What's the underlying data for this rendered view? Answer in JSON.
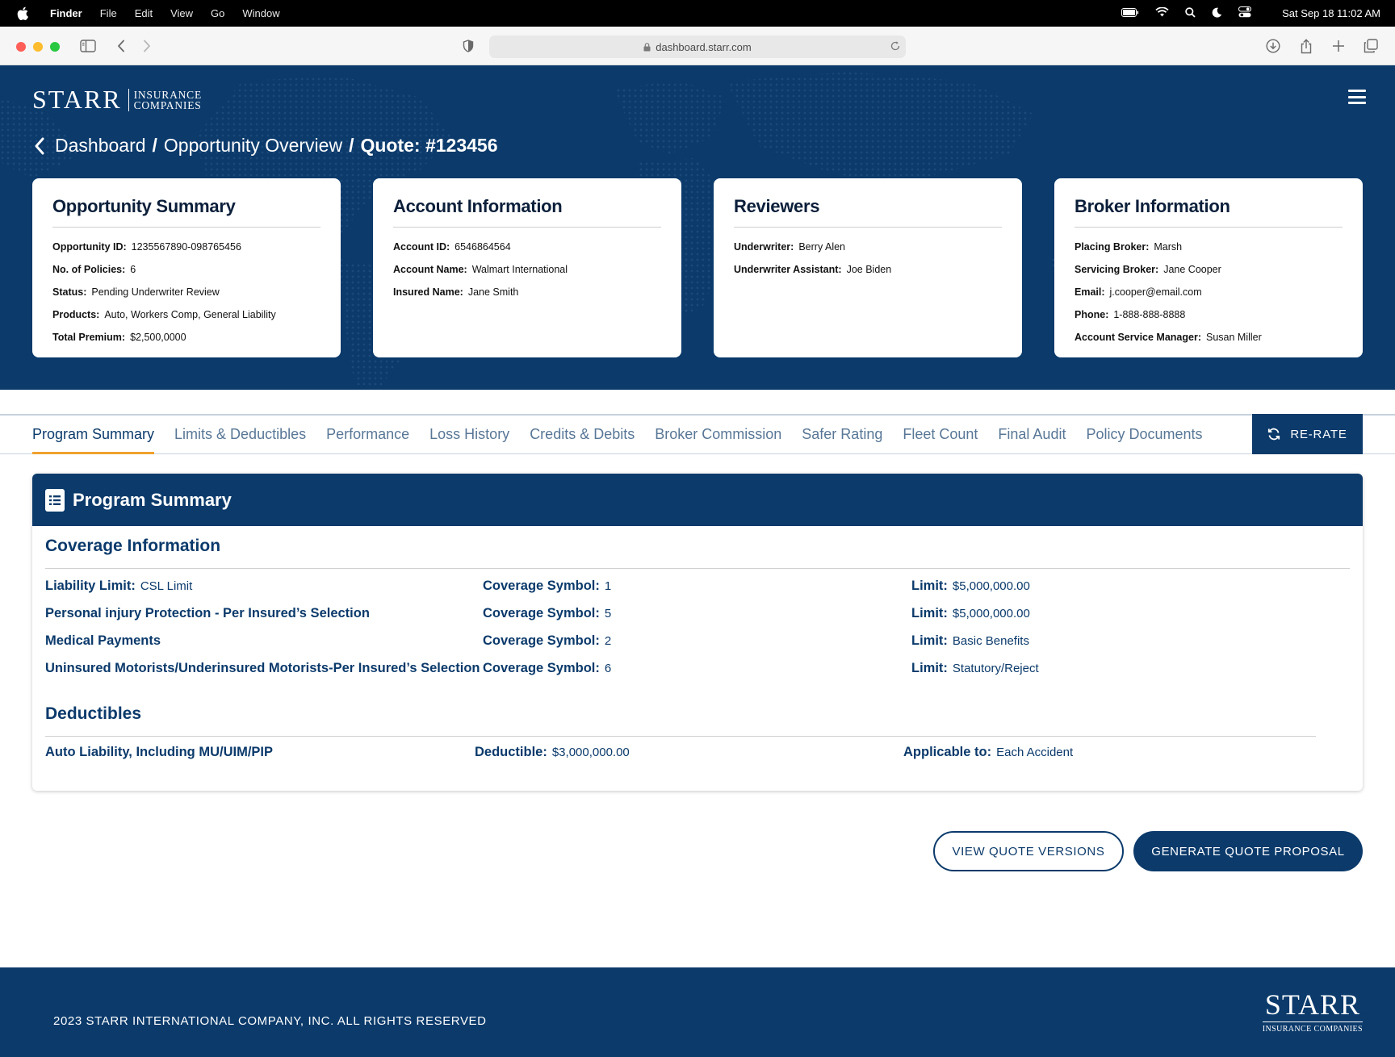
{
  "menubar": {
    "app": "Finder",
    "items": [
      "File",
      "Edit",
      "View",
      "Go",
      "Window"
    ],
    "clock": "Sat Sep 18  11:02 AM",
    "status_icons": [
      "battery-icon",
      "wifi-icon",
      "spotlight-icon",
      "focus-moon-icon",
      "control-center-icon"
    ]
  },
  "browser": {
    "url": "dashboard.starr.com"
  },
  "logo": {
    "name": "STARR",
    "sub1": "INSURANCE",
    "sub2": "COMPANIES"
  },
  "breadcrumb": {
    "items": [
      "Dashboard",
      "Opportunity Overview"
    ],
    "current": "Quote: #123456",
    "separator": "/"
  },
  "cards": [
    {
      "title": "Opportunity Summary",
      "rows": [
        {
          "k": "Opportunity ID:",
          "v": "1235567890-098765456"
        },
        {
          "k": "No. of Policies:",
          "v": "6"
        },
        {
          "k": "Status:",
          "v": "Pending Underwriter Review"
        },
        {
          "k": "Products:",
          "v": "Auto, Workers Comp,  General Liability"
        },
        {
          "k": "Total Premium:",
          "v": "$2,500,0000"
        }
      ]
    },
    {
      "title": "Account Information",
      "rows": [
        {
          "k": "Account ID:",
          "v": "6546864564"
        },
        {
          "k": "Account Name:",
          "v": "Walmart International"
        },
        {
          "k": "Insured Name:",
          "v": "Jane Smith"
        }
      ]
    },
    {
      "title": "Reviewers",
      "rows": [
        {
          "k": "Underwriter:",
          "v": "Berry Alen"
        },
        {
          "k": "Underwriter Assistant:",
          "v": "Joe Biden"
        }
      ]
    },
    {
      "title": "Broker Information",
      "rows": [
        {
          "k": "Placing Broker:",
          "v": "Marsh"
        },
        {
          "k": "Servicing Broker:",
          "v": "Jane Cooper"
        },
        {
          "k": "Email:",
          "v": "j.cooper@email.com"
        },
        {
          "k": "Phone:",
          "v": "1-888-888-8888"
        },
        {
          "k": "Account Service Manager:",
          "v": "Susan Miller"
        }
      ]
    }
  ],
  "tabs": {
    "items": [
      "Program Summary",
      "Limits & Deductibles",
      "Performance",
      "Loss History",
      "Credits & Debits",
      "Broker Commission",
      "Safer Rating",
      "Fleet Count",
      "Final Audit",
      "Policy Documents"
    ],
    "active_index": 0,
    "rerate_label": "RE-RATE"
  },
  "panel": {
    "title": "Program Summary",
    "coverage_title": "Coverage Information",
    "coverage": [
      {
        "name": "Liability Limit:",
        "name_value": "CSL Limit",
        "symbol_label": "Coverage Symbol:",
        "symbol": "1",
        "limit_label": "Limit:",
        "limit": "$5,000,000.00"
      },
      {
        "name": "Personal injury Protection - Per Insured’s Selection",
        "name_value": "",
        "symbol_label": "Coverage Symbol:",
        "symbol": "5",
        "limit_label": "Limit:",
        "limit": "$5,000,000.00"
      },
      {
        "name": "Medical Payments",
        "name_value": "",
        "symbol_label": "Coverage Symbol:",
        "symbol": "2",
        "limit_label": "Limit:",
        "limit": "Basic Benefits"
      },
      {
        "name": "Uninsured Motorists/Underinsured Motorists-Per Insured’s Selection",
        "name_value": "",
        "symbol_label": "Coverage Symbol:",
        "symbol": "6",
        "limit_label": "Limit:",
        "limit": "Statutory/Reject"
      }
    ],
    "deductibles_title": "Deductibles",
    "deductible": {
      "name": "Auto Liability, Including MU/UIM/PIP",
      "ded_label": "Deductible:",
      "ded": "$3,000,000.00",
      "app_label": "Applicable to:",
      "app": "Each Accident"
    }
  },
  "actions": {
    "view_versions": "VIEW QUOTE VERSIONS",
    "generate": "GENERATE QUOTE PROPOSAL"
  },
  "footer": {
    "copyright": "2023 STARR INTERNATIONAL COMPANY, INC. ALL RIGHTS RESERVED",
    "logo_big": "STARR",
    "logo_small": "INSURANCE COMPANIES"
  },
  "colors": {
    "brand_navy": "#0b3a6b",
    "tab_active_underline": "#f0a12e",
    "tab_inactive": "#587796"
  }
}
